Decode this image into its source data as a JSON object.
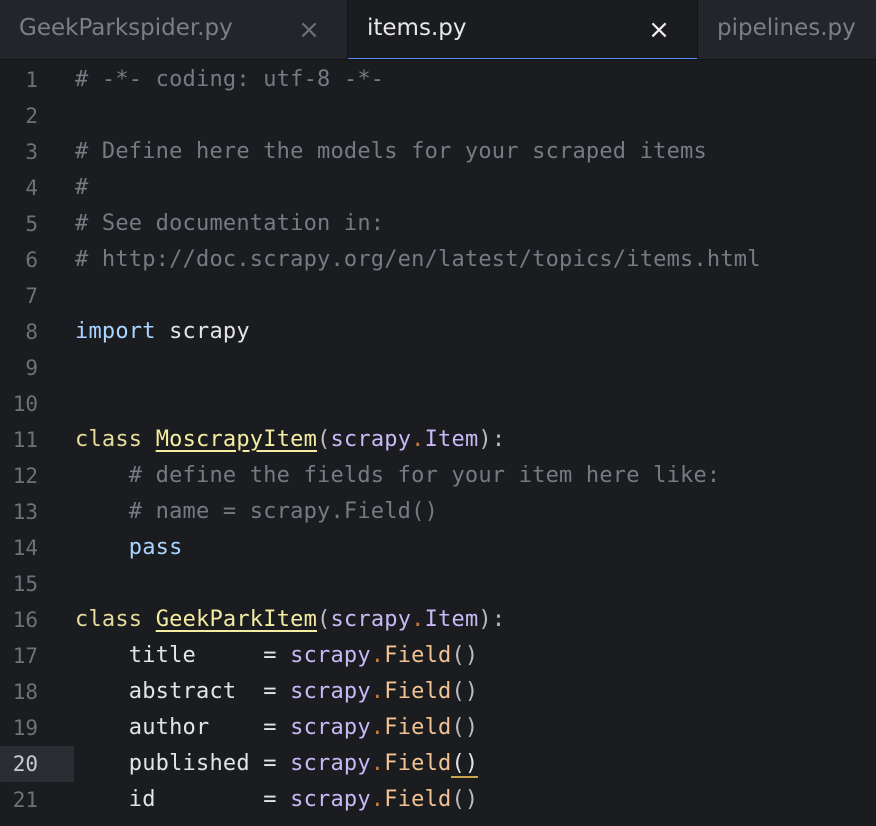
{
  "tabs": [
    {
      "label": "GeekParkspider.py",
      "close": "×",
      "active": false
    },
    {
      "label": "items.py",
      "close": "×",
      "active": true
    },
    {
      "label": "pipelines.py",
      "active": false
    }
  ],
  "editor": {
    "language": "python",
    "current_line": 20,
    "lines": [
      {
        "number": "1",
        "tokens": [
          {
            "type": "comment",
            "text": "# -*- coding: utf-8 -*-"
          }
        ]
      },
      {
        "number": "2",
        "tokens": []
      },
      {
        "number": "3",
        "tokens": [
          {
            "type": "comment",
            "text": "# Define here the models for your scraped items"
          }
        ]
      },
      {
        "number": "4",
        "tokens": [
          {
            "type": "comment",
            "text": "#"
          }
        ]
      },
      {
        "number": "5",
        "tokens": [
          {
            "type": "comment",
            "text": "# See documentation in:"
          }
        ]
      },
      {
        "number": "6",
        "tokens": [
          {
            "type": "comment",
            "text": "# http://doc.scrapy.org/en/latest/topics/items.html"
          }
        ]
      },
      {
        "number": "7",
        "tokens": []
      },
      {
        "number": "8",
        "tokens": [
          {
            "type": "keyword",
            "text": "import"
          },
          {
            "type": "plain",
            "text": " scrapy"
          }
        ]
      },
      {
        "number": "9",
        "tokens": []
      },
      {
        "number": "10",
        "tokens": []
      },
      {
        "number": "11",
        "tokens": [
          {
            "type": "class-kw",
            "text": "class"
          },
          {
            "type": "plain",
            "text": " "
          },
          {
            "type": "class",
            "text": "MoscrapyItem"
          },
          {
            "type": "punct",
            "text": "("
          },
          {
            "type": "module",
            "text": "scrapy"
          },
          {
            "type": "dot",
            "text": "."
          },
          {
            "type": "module",
            "text": "Item"
          },
          {
            "type": "punct",
            "text": "):"
          }
        ]
      },
      {
        "number": "12",
        "tokens": [
          {
            "type": "plain",
            "text": "    "
          },
          {
            "type": "comment",
            "text": "# define the fields for your item here like:"
          }
        ]
      },
      {
        "number": "13",
        "tokens": [
          {
            "type": "plain",
            "text": "    "
          },
          {
            "type": "comment",
            "text": "# name = scrapy.Field()"
          }
        ]
      },
      {
        "number": "14",
        "tokens": [
          {
            "type": "plain",
            "text": "    "
          },
          {
            "type": "keyword",
            "text": "pass"
          }
        ]
      },
      {
        "number": "15",
        "tokens": []
      },
      {
        "number": "16",
        "tokens": [
          {
            "type": "class-kw",
            "text": "class"
          },
          {
            "type": "plain",
            "text": " "
          },
          {
            "type": "class",
            "text": "GeekParkItem"
          },
          {
            "type": "punct",
            "text": "("
          },
          {
            "type": "module",
            "text": "scrapy"
          },
          {
            "type": "dot",
            "text": "."
          },
          {
            "type": "module",
            "text": "Item"
          },
          {
            "type": "punct",
            "text": "):"
          }
        ]
      },
      {
        "number": "17",
        "tokens": [
          {
            "type": "plain",
            "text": "    title     = "
          },
          {
            "type": "module",
            "text": "scrapy"
          },
          {
            "type": "dot",
            "text": "."
          },
          {
            "type": "method",
            "text": "Field"
          },
          {
            "type": "punct",
            "text": "()"
          }
        ]
      },
      {
        "number": "18",
        "tokens": [
          {
            "type": "plain",
            "text": "    abstract  = "
          },
          {
            "type": "module",
            "text": "scrapy"
          },
          {
            "type": "dot",
            "text": "."
          },
          {
            "type": "method",
            "text": "Field"
          },
          {
            "type": "punct",
            "text": "()"
          }
        ]
      },
      {
        "number": "19",
        "tokens": [
          {
            "type": "plain",
            "text": "    author    = "
          },
          {
            "type": "module",
            "text": "scrapy"
          },
          {
            "type": "dot",
            "text": "."
          },
          {
            "type": "method",
            "text": "Field"
          },
          {
            "type": "punct",
            "text": "()"
          }
        ]
      },
      {
        "number": "20",
        "tokens": [
          {
            "type": "plain",
            "text": "    published = "
          },
          {
            "type": "module",
            "text": "scrapy"
          },
          {
            "type": "dot",
            "text": "."
          },
          {
            "type": "method",
            "text": "Field"
          },
          {
            "type": "paren-hl",
            "text": "()"
          }
        ]
      },
      {
        "number": "21",
        "tokens": [
          {
            "type": "plain",
            "text": "    id        = "
          },
          {
            "type": "module",
            "text": "scrapy"
          },
          {
            "type": "dot",
            "text": "."
          },
          {
            "type": "method",
            "text": "Field"
          },
          {
            "type": "punct",
            "text": "()"
          }
        ]
      }
    ]
  }
}
